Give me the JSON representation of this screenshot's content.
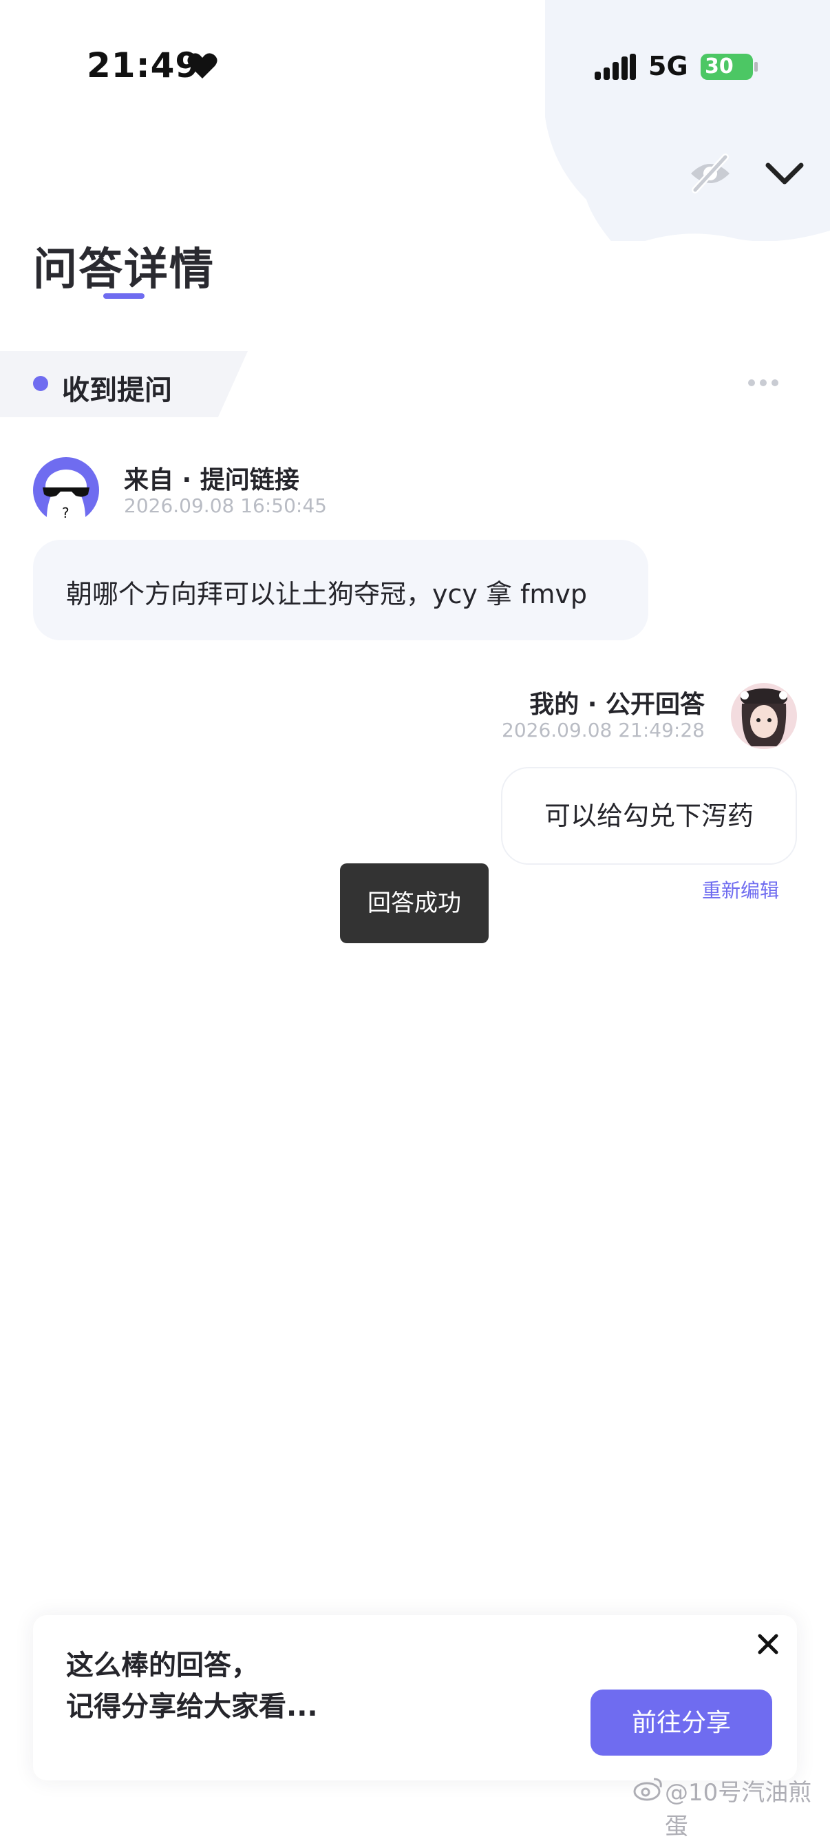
{
  "status_bar": {
    "time": "21:49",
    "network": "5G",
    "battery": "30"
  },
  "page": {
    "title": "问答详情"
  },
  "section": {
    "label": "收到提问"
  },
  "question": {
    "from": "来自 · 提问链接",
    "timestamp": "2026.09.08 16:50:45",
    "text": "朝哪个方向拜可以让土狗夺冠，ycy 拿 fmvp"
  },
  "answer": {
    "author": "我的 · 公开回答",
    "timestamp": "2026.09.08 21:49:28",
    "text": "可以给勾兑下泻药",
    "edit_label": "重新编辑"
  },
  "toast": {
    "message": "回答成功"
  },
  "share_card": {
    "line1": "这么棒的回答，",
    "line2": "记得分享给大家看...",
    "button_label": "前往分享"
  },
  "watermark": {
    "text": "@10号汽油煎蛋"
  },
  "colors": {
    "accent": "#6f6cf0",
    "bubble_bg": "#f4f6fb",
    "toast_bg": "#333333",
    "battery": "#4cc764"
  }
}
